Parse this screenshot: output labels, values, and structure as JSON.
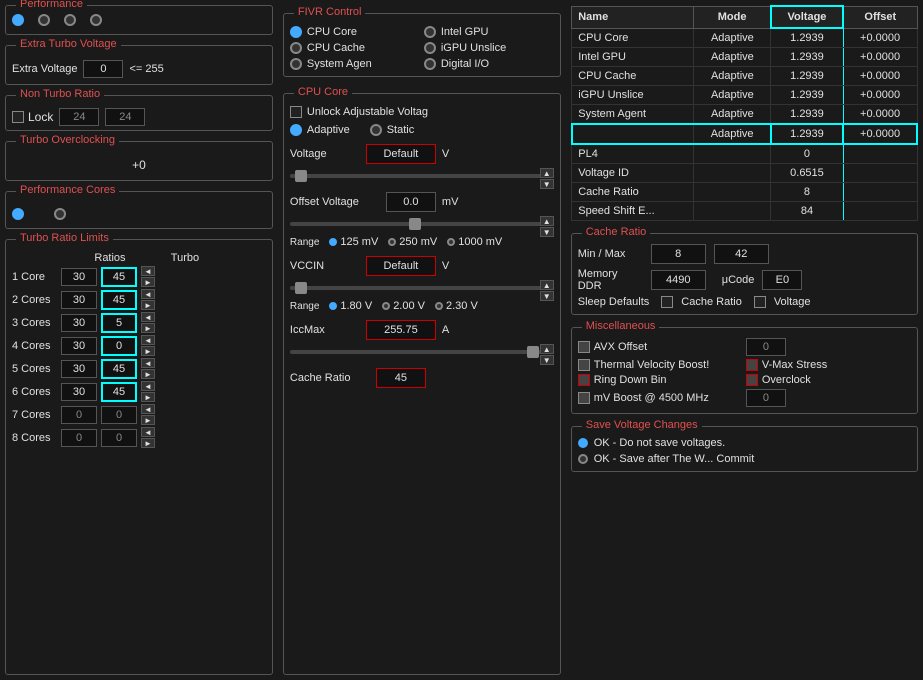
{
  "left": {
    "performance_title": "Performance",
    "extra_voltage_title": "Extra Turbo Voltage",
    "extra_voltage_label": "Extra Voltage",
    "extra_voltage_value": "0",
    "extra_voltage_max": "<= 255",
    "non_turbo_title": "Non Turbo Ratio",
    "lock_label": "Lock",
    "ratio1": "24",
    "ratio2": "24",
    "turbo_oc_title": "Turbo Overclocking",
    "turbo_oc_val": "+0",
    "perf_cores_title": "Performance Cores",
    "turbo_ratio_title": "Turbo Ratio Limits",
    "ratios_label": "Ratios",
    "turbo_label": "Turbo",
    "rows": [
      {
        "label": "1 Core",
        "ratio": "30",
        "turbo": "45",
        "active": true
      },
      {
        "label": "2 Cores",
        "ratio": "30",
        "turbo": "45",
        "active": true
      },
      {
        "label": "3 Cores",
        "ratio": "30",
        "turbo": "5",
        "active": true
      },
      {
        "label": "4 Cores",
        "ratio": "30",
        "turbo": "0",
        "active": true
      },
      {
        "label": "5 Cores",
        "ratio": "30",
        "turbo": "45",
        "active": true
      },
      {
        "label": "6 Cores",
        "ratio": "30",
        "turbo": "45",
        "active": true
      },
      {
        "label": "7 Cores",
        "ratio": "0",
        "turbo": "0",
        "active": false
      },
      {
        "label": "8 Cores",
        "ratio": "0",
        "turbo": "0",
        "active": false
      }
    ]
  },
  "mid": {
    "fivr_title": "FIVR Control",
    "cpu_core_radio": "CPU Core",
    "cpu_cache_radio": "CPU Cache",
    "system_agen_radio": "System Agen",
    "intel_gpu_radio": "Intel GPU",
    "igpu_unslice_radio": "iGPU Unslice",
    "digital_io_radio": "Digital I/O",
    "cpu_core_box_title": "CPU Core",
    "unlock_label": "Unlock Adjustable Voltag",
    "adaptive_label": "Adaptive",
    "static_label": "Static",
    "voltage_label": "Voltage",
    "voltage_value": "Default",
    "voltage_unit": "V",
    "offset_voltage_label": "Offset Voltage",
    "offset_value": "0.0",
    "offset_unit": "mV",
    "range_125": "125 mV",
    "range_250": "250 mV",
    "range_1000": "1000 mV",
    "vccin_label": "VCCIN",
    "vccin_value": "Default",
    "vccin_unit": "V",
    "range_180": "1.80 V",
    "range_200": "2.00 V",
    "range_230": "2.30 V",
    "iccmax_label": "IccMax",
    "iccmax_value": "255.75",
    "iccmax_unit": "A",
    "cache_ratio_label": "Cache Ratio",
    "cache_ratio_value": "45"
  },
  "right": {
    "table_headers": {
      "name": "Name",
      "mode": "Mode",
      "voltage": "Voltage",
      "offset": "Offset"
    },
    "table_rows": [
      {
        "name": "CPU Core",
        "mode": "Adaptive",
        "voltage": "1.2939",
        "offset": "+0.0000"
      },
      {
        "name": "Intel GPU",
        "mode": "Adaptive",
        "voltage": "1.2939",
        "offset": "+0.0000"
      },
      {
        "name": "CPU Cache",
        "mode": "Adaptive",
        "voltage": "1.2939",
        "offset": "+0.0000"
      },
      {
        "name": "iGPU Unslice",
        "mode": "Adaptive",
        "voltage": "1.2939",
        "offset": "+0.0000"
      },
      {
        "name": "System Agent",
        "mode": "Adaptive",
        "voltage": "1.2939",
        "offset": "+0.0000"
      },
      {
        "name": "",
        "mode": "Adaptive",
        "voltage": "1.2939",
        "offset": "+0.0000",
        "selected": true
      },
      {
        "name": "PL4",
        "mode": "",
        "voltage": "0",
        "offset": ""
      },
      {
        "name": "Voltage ID",
        "mode": "",
        "voltage": "0.6515",
        "offset": ""
      },
      {
        "name": "Cache Ratio",
        "mode": "",
        "voltage": "8",
        "offset": ""
      },
      {
        "name": "Speed Shift E...",
        "mode": "",
        "voltage": "84",
        "offset": ""
      }
    ],
    "cache_ratio_title": "Cache Ratio",
    "min_max_label": "Min / Max",
    "min_val": "8",
    "max_val": "42",
    "memory_ddr_label": "Memory DDR",
    "memory_ddr_val": "4490",
    "ucode_label": "μCode",
    "ucode_val": "E0",
    "sleep_defaults_label": "Sleep Defaults",
    "cache_ratio_check": "Cache Ratio",
    "voltage_check": "Voltage",
    "misc_title": "Miscellaneous",
    "avx_offset_label": "AVX Offset",
    "avx_val": "0",
    "thermal_vel_label": "Thermal Velocity Boost!",
    "vmax_label": "V-Max Stress",
    "ring_down_label": "Ring Down Bin",
    "overclock_label": "Overclock",
    "mv_boost_label": "mV Boost @ 4500 MHz",
    "mv_val": "0",
    "save_title": "Save Voltage Changes",
    "save_opt1": "OK - Do not save voltages.",
    "save_opt2": "OK - Save after The W... Commit"
  }
}
